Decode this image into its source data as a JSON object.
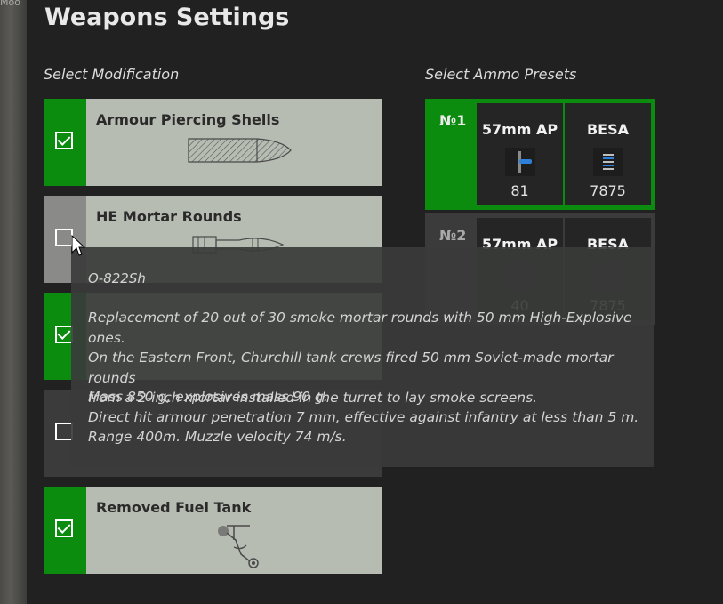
{
  "background": {
    "corner_text": "Moo"
  },
  "window": {
    "title": "Weapons Settings"
  },
  "modifications": {
    "label": "Select Modification",
    "items": [
      {
        "name": "Armour Piercing Shells",
        "checked": true,
        "icon": "ap-shell-icon"
      },
      {
        "name": "HE Mortar Rounds",
        "checked": false,
        "icon": "mortar-round-icon"
      },
      {
        "name": "",
        "checked": true,
        "icon": ""
      },
      {
        "name": "",
        "checked": false,
        "icon": ""
      },
      {
        "name": "Removed Fuel Tank",
        "checked": true,
        "icon": "fuel-tank-icon"
      }
    ]
  },
  "ammo_presets": {
    "label": "Select Ammo Presets",
    "items": [
      {
        "number": "№1",
        "selected": true,
        "slots": [
          {
            "name": "57mm AP",
            "count": "81",
            "icon": "ap-round-icon"
          },
          {
            "name": "BESA",
            "count": "7875",
            "icon": "mg-belt-icon"
          }
        ]
      },
      {
        "number": "№2",
        "selected": false,
        "slots": [
          {
            "name": "57mm AP",
            "count": "40",
            "icon": "ap-round-icon"
          },
          {
            "name": "BESA",
            "count": "7875",
            "icon": "mg-belt-icon"
          }
        ]
      }
    ]
  },
  "tooltip": {
    "name": "O-822Sh",
    "description": [
      "Replacement of 20 out of 30 smoke mortar rounds with 50 mm High-Explosive ones.",
      "On the Eastern Front, Churchill tank crews fired 50 mm Soviet-made mortar rounds",
      "from a 2-inch mortar installed in the turret to lay smoke screens."
    ],
    "stats": [
      "Mass 850 g, explosives mass 90 g.",
      "Direct hit armour penetration 7 mm, effective against infantry at less than 5 m.",
      "Range 400m. Muzzle velocity 74 m/s."
    ]
  },
  "colors": {
    "accent": "#0b8c0f",
    "card": "#b6bcb2",
    "panel": "#202120",
    "slot_icon_blue": "#2e7fd8"
  }
}
